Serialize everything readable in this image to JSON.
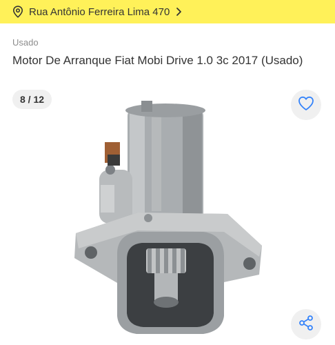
{
  "header": {
    "address": "Rua Antônio Ferreira Lima 470",
    "location_icon": "location-pin-icon",
    "chevron_icon": "chevron-right-icon",
    "background_color": "#fff159"
  },
  "listing": {
    "condition": "Usado",
    "title": "Motor De Arranque Fiat Mobi Drive 1.0 3c 2017 (Usado)"
  },
  "gallery": {
    "counter": "8 / 12",
    "favorite_icon": "heart-icon",
    "share_icon": "share-icon",
    "accent_color": "#3483fa"
  }
}
